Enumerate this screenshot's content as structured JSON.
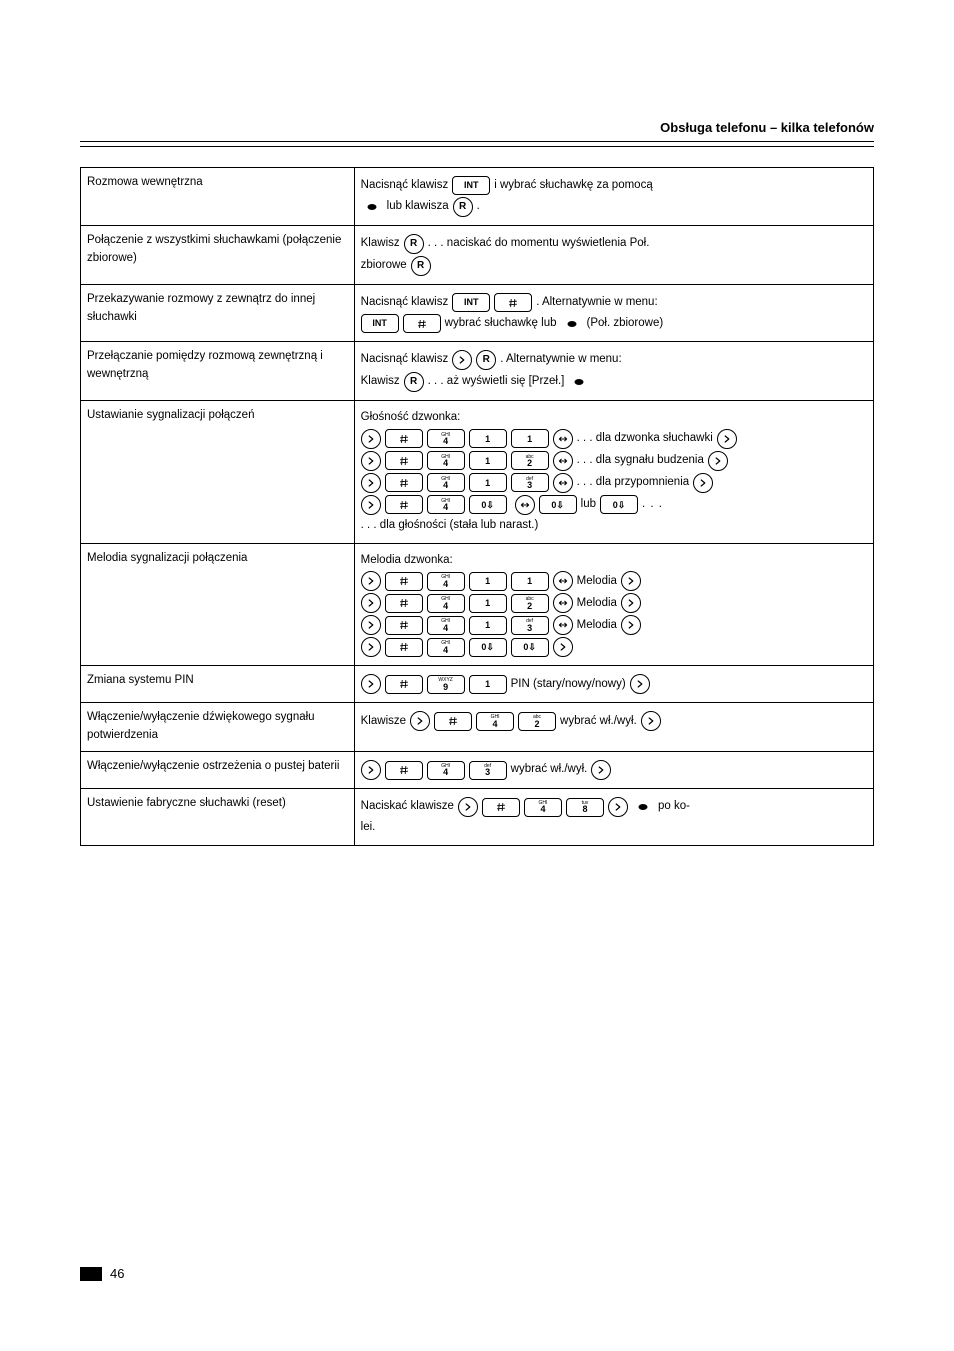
{
  "header": {
    "title": "Obsługa telefonu – kilka telefonów"
  },
  "footer": {
    "page": "46"
  },
  "rows": [
    {
      "label": "Rozmowa wewnętrzna",
      "proc_lines": [
        {
          "type": "icons_text",
          "items": [
            {
              "t": "text",
              "v": "Nacisnąć klawisz "
            },
            {
              "t": "key",
              "v": "INT"
            },
            {
              "t": "text",
              "v": " i wybrać słuchawkę za pomocą"
            }
          ]
        },
        {
          "type": "icons_text",
          "items": [
            {
              "t": "circ",
              "icon": "updown"
            },
            {
              "t": "text",
              "v": " lub klawisza "
            },
            {
              "t": "circ",
              "v": "R"
            },
            {
              "t": "text",
              "v": "."
            }
          ]
        }
      ]
    },
    {
      "label": "Połączenie z wszystkimi słuchawkami (połączenie zbiorowe)",
      "proc_lines": [
        {
          "type": "icons_text",
          "items": [
            {
              "t": "text",
              "v": "Klawisz "
            },
            {
              "t": "circ",
              "v": "R"
            },
            {
              "t": "text",
              "v": " . . . naciskać do momentu wyświetlenia Poł."
            }
          ]
        },
        {
          "type": "icons_text",
          "items": [
            {
              "t": "text",
              "v": "zbiorowe "
            },
            {
              "t": "circ",
              "v": "R"
            }
          ]
        }
      ]
    },
    {
      "label": "Przekazywanie rozmowy z zewnątrz do innej słuchawki",
      "proc_lines": [
        {
          "type": "icons_text",
          "items": [
            {
              "t": "text",
              "v": "Nacisnąć klawisz "
            },
            {
              "t": "key",
              "v": "INT"
            },
            {
              "t": "key",
              "icon": "hash"
            },
            {
              "t": "text",
              "v": " . Alternatywnie w menu:"
            }
          ]
        },
        {
          "type": "icons_text",
          "items": [
            {
              "t": "key",
              "v": "INT"
            },
            {
              "t": "key",
              "icon": "hash"
            },
            {
              "t": "text",
              "v": " wybrać słuchawkę lub "
            },
            {
              "t": "circ",
              "icon": "updown"
            },
            {
              "t": "text",
              "v": " (Poł. zbiorowe)"
            }
          ]
        }
      ]
    },
    {
      "label": "Przełączanie pomiędzy rozmową zewnętrzną i wewnętrzną",
      "proc_lines": [
        {
          "type": "icons_text",
          "items": [
            {
              "t": "text",
              "v": "Nacisnąć klawisz "
            },
            {
              "t": "circ",
              "icon": "right"
            },
            {
              "t": "circ",
              "v": "R"
            },
            {
              "t": "text",
              "v": " . Alternatywnie w menu:"
            }
          ]
        },
        {
          "type": "icons_text",
          "items": [
            {
              "t": "text",
              "v": "Klawisz "
            },
            {
              "t": "circ",
              "v": "R"
            },
            {
              "t": "text",
              "v": " . . . aż wyświetli się [Przeł.] "
            },
            {
              "t": "circ",
              "icon": "updown"
            }
          ]
        }
      ]
    },
    {
      "label": "Ustawianie sygnalizacji połączeń",
      "proc_lines": [
        {
          "type": "plain",
          "v": "Głośność dzwonka:"
        },
        {
          "type": "icons_text",
          "items": [
            {
              "t": "circ",
              "icon": "right"
            },
            {
              "t": "key",
              "icon": "hash"
            },
            {
              "t": "numkey",
              "letters": "GHI",
              "digit": "4"
            },
            {
              "t": "numkey",
              "digit": "1"
            },
            {
              "t": "numkey",
              "digit": "1"
            },
            {
              "t": "circ",
              "icon": "lr"
            },
            {
              "t": "text",
              "v": ". . . dla dzwonka słuchawki "
            },
            {
              "t": "circ",
              "icon": "right"
            }
          ]
        },
        {
          "type": "icons_text",
          "items": [
            {
              "t": "circ",
              "icon": "right"
            },
            {
              "t": "key",
              "icon": "hash"
            },
            {
              "t": "numkey",
              "letters": "GHI",
              "digit": "4"
            },
            {
              "t": "numkey",
              "digit": "1"
            },
            {
              "t": "numkey",
              "letters": "abc",
              "digit": "2"
            },
            {
              "t": "circ",
              "icon": "lr"
            },
            {
              "t": "text",
              "v": ". . . dla sygnału budzenia "
            },
            {
              "t": "circ",
              "icon": "right"
            }
          ]
        },
        {
          "type": "icons_text",
          "items": [
            {
              "t": "circ",
              "icon": "right"
            },
            {
              "t": "key",
              "icon": "hash"
            },
            {
              "t": "numkey",
              "letters": "GHI",
              "digit": "4"
            },
            {
              "t": "numkey",
              "digit": "1"
            },
            {
              "t": "numkey",
              "letters": "def",
              "digit": "3"
            },
            {
              "t": "circ",
              "icon": "lr"
            },
            {
              "t": "text",
              "v": ". . . dla przypomnienia "
            },
            {
              "t": "circ",
              "icon": "right"
            }
          ]
        },
        {
          "type": "icons_text",
          "items": [
            {
              "t": "circ",
              "icon": "right"
            },
            {
              "t": "key",
              "icon": "hash"
            },
            {
              "t": "numkey",
              "letters": "GHI",
              "digit": "4"
            },
            {
              "t": "numkey",
              "digit": "0⇩"
            },
            {
              "t": "text",
              "v": " "
            },
            {
              "t": "circ",
              "icon": "lr"
            },
            {
              "t": "numkey",
              "digit": "0⇩"
            },
            {
              "t": "text",
              "v": " lub "
            },
            {
              "t": "numkey",
              "digit": "0⇩"
            },
            {
              "t": "ellips"
            }
          ]
        },
        {
          "type": "plain",
          "v": ". . . dla głośności (stała lub narast.)"
        }
      ]
    },
    {
      "label": "Melodia sygnalizacji połączenia",
      "proc_lines": [
        {
          "type": "plain",
          "v": "Melodia dzwonka:"
        },
        {
          "type": "icons_text",
          "items": [
            {
              "t": "circ",
              "icon": "right"
            },
            {
              "t": "key",
              "icon": "hash"
            },
            {
              "t": "numkey",
              "letters": "GHI",
              "digit": "4"
            },
            {
              "t": "numkey",
              "digit": "1"
            },
            {
              "t": "numkey",
              "digit": "1"
            },
            {
              "t": "circ",
              "icon": "lr"
            },
            {
              "t": "text",
              "v": " Melodia "
            },
            {
              "t": "circ",
              "icon": "right"
            }
          ]
        },
        {
          "type": "icons_text",
          "items": [
            {
              "t": "circ",
              "icon": "right"
            },
            {
              "t": "key",
              "icon": "hash"
            },
            {
              "t": "numkey",
              "letters": "GHI",
              "digit": "4"
            },
            {
              "t": "numkey",
              "digit": "1"
            },
            {
              "t": "numkey",
              "letters": "abc",
              "digit": "2"
            },
            {
              "t": "circ",
              "icon": "lr"
            },
            {
              "t": "text",
              "v": " Melodia "
            },
            {
              "t": "circ",
              "icon": "right"
            }
          ]
        },
        {
          "type": "icons_text",
          "items": [
            {
              "t": "circ",
              "icon": "right"
            },
            {
              "t": "key",
              "icon": "hash"
            },
            {
              "t": "numkey",
              "letters": "GHI",
              "digit": "4"
            },
            {
              "t": "numkey",
              "digit": "1"
            },
            {
              "t": "numkey",
              "letters": "def",
              "digit": "3"
            },
            {
              "t": "circ",
              "icon": "lr"
            },
            {
              "t": "text",
              "v": " Melodia "
            },
            {
              "t": "circ",
              "icon": "right"
            }
          ]
        },
        {
          "type": "icons_text",
          "items": [
            {
              "t": "circ",
              "icon": "right"
            },
            {
              "t": "key",
              "icon": "hash"
            },
            {
              "t": "numkey",
              "letters": "GHI",
              "digit": "4"
            },
            {
              "t": "numkey",
              "digit": "0⇩"
            },
            {
              "t": "numkey",
              "digit": "0⇩"
            },
            {
              "t": "circ",
              "icon": "right"
            }
          ]
        }
      ]
    },
    {
      "label": "Zmiana systemu PIN",
      "proc_lines": [
        {
          "type": "icons_text",
          "items": [
            {
              "t": "circ",
              "icon": "right"
            },
            {
              "t": "key",
              "icon": "hash"
            },
            {
              "t": "numkey",
              "letters": "WXYZ",
              "digit": "9"
            },
            {
              "t": "numkey",
              "digit": "1"
            },
            {
              "t": "text",
              "v": " PIN (stary/nowy/nowy) "
            },
            {
              "t": "circ",
              "icon": "right"
            }
          ]
        }
      ]
    },
    {
      "label": "Włączenie/wyłączenie dźwiękowego sygnału potwierdzenia",
      "proc_lines": [
        {
          "type": "icons_text",
          "items": [
            {
              "t": "text",
              "v": "Klawisze "
            },
            {
              "t": "circ",
              "icon": "right"
            },
            {
              "t": "key",
              "icon": "hash"
            },
            {
              "t": "numkey",
              "letters": "GHI",
              "digit": "4"
            },
            {
              "t": "numkey",
              "letters": "abc",
              "digit": "2"
            },
            {
              "t": "text",
              "v": " wybrać wł./wył. "
            },
            {
              "t": "circ",
              "icon": "right"
            }
          ]
        }
      ]
    },
    {
      "label": "Włączenie/wyłączenie ostrzeżenia o pustej baterii",
      "proc_lines": [
        {
          "type": "icons_text",
          "items": [
            {
              "t": "circ",
              "icon": "right"
            },
            {
              "t": "key",
              "icon": "hash"
            },
            {
              "t": "numkey",
              "letters": "GHI",
              "digit": "4"
            },
            {
              "t": "numkey",
              "letters": "def",
              "digit": "3"
            },
            {
              "t": "text",
              "v": " wybrać wł./wył. "
            },
            {
              "t": "circ",
              "icon": "right"
            }
          ]
        }
      ]
    },
    {
      "label": "Ustawienie fabryczne słuchawki (reset)",
      "proc_lines": [
        {
          "type": "icons_text",
          "items": [
            {
              "t": "text",
              "v": "Naciskać klawisze "
            },
            {
              "t": "circ",
              "icon": "right"
            },
            {
              "t": "key",
              "icon": "hash"
            },
            {
              "t": "numkey",
              "letters": "GHI",
              "digit": "4"
            },
            {
              "t": "numkey",
              "letters": "tuv",
              "digit": "8"
            },
            {
              "t": "circ",
              "icon": "right"
            },
            {
              "t": "circ",
              "icon": "updown"
            },
            {
              "t": "text",
              "v": " po ko-"
            }
          ]
        },
        {
          "type": "plain",
          "v": "lei."
        }
      ]
    }
  ]
}
